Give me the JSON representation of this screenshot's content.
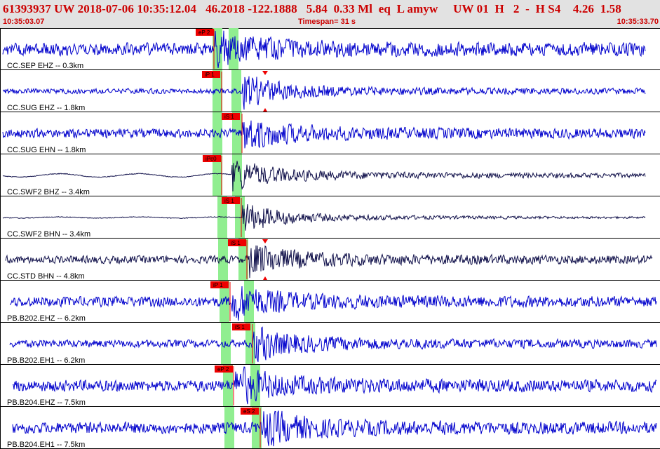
{
  "header": {
    "title": "61393937 UW 2018-07-06 10:35:12.04   46.2018 -122.1888   5.84  0.33 Ml  eq  L amyw     UW 01  H   2  -  H S4    4.26  1.58",
    "start_time": "10:35:03.07",
    "timespan": "Timespan=  31 s",
    "end_time": "10:35:33.70"
  },
  "colors": {
    "trace_blue": "#0000cc",
    "trace_dark": "#10104a",
    "pick_red": "#ee0000",
    "band_green": "#90ee90",
    "header_bg": "#e2e2e2",
    "header_text": "#cc0000"
  },
  "traces": [
    {
      "label": "CC.SEP EHZ -- 0.3km",
      "color": "blue",
      "amp": 10,
      "wave": "noise",
      "p_pick": "eP 2",
      "s_pick": ""
    },
    {
      "label": "CC.SUG EHZ -- 1.8km",
      "color": "blue",
      "amp": 4,
      "wave": "noise",
      "p_pick": "iP 1",
      "s_pick": ""
    },
    {
      "label": "CC.SUG EHN -- 1.8km",
      "color": "blue",
      "amp": 7,
      "wave": "noise",
      "p_pick": "",
      "s_pick": "iS 1"
    },
    {
      "label": "CC.SWF2 BHZ -- 3.4km",
      "color": "dark",
      "amp": 3,
      "wave": "smooth",
      "p_pick": "iPc0",
      "s_pick": ""
    },
    {
      "label": "CC.SWF2 BHN -- 3.4km",
      "color": "dark",
      "amp": 1,
      "wave": "smooth",
      "p_pick": "",
      "s_pick": "iS 1"
    },
    {
      "label": "CC.STD BHN -- 4.8km",
      "color": "dark",
      "amp": 6,
      "wave": "noise",
      "p_pick": "",
      "s_pick": "iS 1"
    },
    {
      "label": "PB.B202.EHZ -- 6.2km",
      "color": "blue",
      "amp": 8,
      "wave": "noise",
      "p_pick": "iP 1",
      "s_pick": ""
    },
    {
      "label": "PB.B202.EH1 -- 6.2km",
      "color": "blue",
      "amp": 6,
      "wave": "noise",
      "p_pick": "",
      "s_pick": "iS 1"
    },
    {
      "label": "PB.B204.EHZ -- 7.5km",
      "color": "blue",
      "amp": 9,
      "wave": "noise",
      "p_pick": "eP 2",
      "s_pick": ""
    },
    {
      "label": "PB.B204.EH1 -- 7.5km",
      "color": "blue",
      "amp": 9,
      "wave": "noise",
      "p_pick": "",
      "s_pick": "eS 2"
    }
  ]
}
